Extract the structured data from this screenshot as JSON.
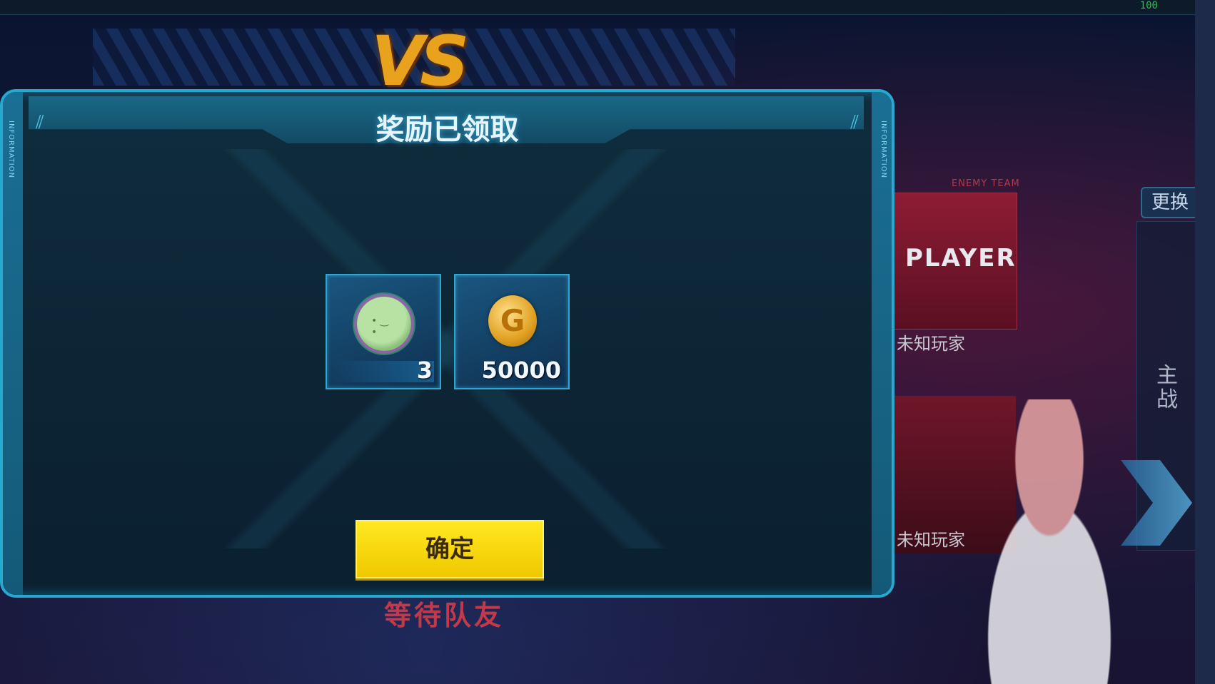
{
  "header": {
    "fps": "100",
    "vs": "VS"
  },
  "dialog": {
    "title": "奖励已领取",
    "side_label": "INFORMATION",
    "rewards": [
      {
        "icon": "haro-icon",
        "quantity": "3"
      },
      {
        "icon": "gold-coin-icon",
        "quantity": "50000",
        "coin_symbol": "G"
      }
    ],
    "confirm_label": "确定"
  },
  "background": {
    "enemy_team_tag": "ENEMY TEAM",
    "player_word": "PLAYER",
    "unknown_player_1": "未知玩家",
    "unknown_player_2": "未知玩家",
    "change_button": "更换",
    "main_battle_label": "主战",
    "waiting_label": "等待队友"
  },
  "colors": {
    "accent": "#27a9cf",
    "button": "#ffe820",
    "enemy": "#8e1c34"
  }
}
